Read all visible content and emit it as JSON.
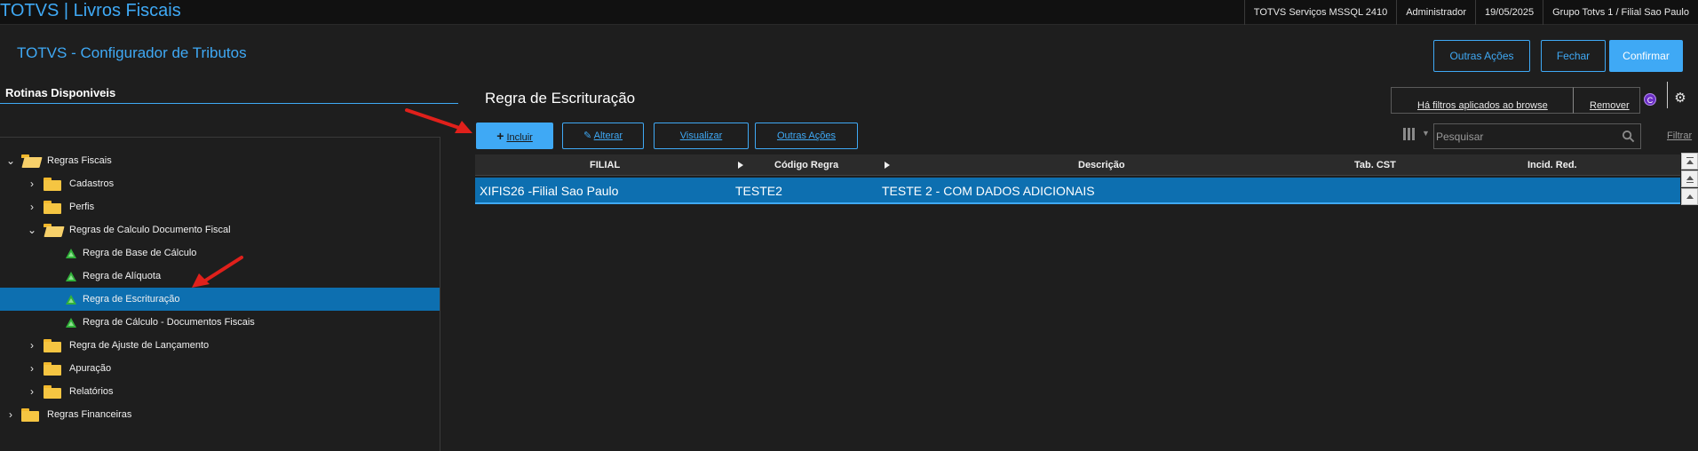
{
  "topbar": {
    "app_title": "TOTVS | Livros Fiscais",
    "server": "TOTVS Serviços MSSQL 2410",
    "user": "Administrador",
    "date": "19/05/2025",
    "branch": "Grupo Totvs 1 / Filial Sao Paulo"
  },
  "header": {
    "title": "TOTVS - Configurador de Tributos",
    "other_actions": "Outras Ações",
    "close": "Fechar",
    "confirm": "Confirmar"
  },
  "left_panel": {
    "title": "Rotinas Disponiveis",
    "tree": [
      {
        "label": "Regras Fiscais",
        "level": 0,
        "kind": "folder-open",
        "expanded": true
      },
      {
        "label": "Cadastros",
        "level": 1,
        "kind": "folder",
        "expanded": false
      },
      {
        "label": "Perfis",
        "level": 1,
        "kind": "folder",
        "expanded": false
      },
      {
        "label": "Regras de Calculo Documento Fiscal",
        "level": 1,
        "kind": "folder-open",
        "expanded": true
      },
      {
        "label": "Regra de Base de Cálculo",
        "level": 2,
        "kind": "leaf"
      },
      {
        "label": "Regra de Alíquota",
        "level": 2,
        "kind": "leaf"
      },
      {
        "label": "Regra de Escrituração",
        "level": 2,
        "kind": "leaf",
        "selected": true
      },
      {
        "label": "Regra de Cálculo - Documentos Fiscais",
        "level": 2,
        "kind": "leaf"
      },
      {
        "label": "Regra de Ajuste de Lançamento",
        "level": 1,
        "kind": "folder",
        "expanded": false
      },
      {
        "label": "Apuração",
        "level": 1,
        "kind": "folder",
        "expanded": false
      },
      {
        "label": "Relatórios",
        "level": 1,
        "kind": "folder",
        "expanded": false
      },
      {
        "label": "Regras Financeiras",
        "level": 0,
        "kind": "folder",
        "expanded": false
      }
    ]
  },
  "browse": {
    "title": "Regra de Escrituração",
    "filters_applied": "Há filtros aplicados ao browse",
    "remove": "Remover",
    "badge": "C",
    "actions": {
      "include": "Incluir",
      "alter": "Alterar",
      "view": "Visualizar",
      "other": "Outras Ações"
    },
    "search_placeholder": "Pesquisar",
    "filter_link": "Filtrar",
    "columns": [
      "FILIAL",
      "Código Regra",
      "Descrição",
      "Tab. CST",
      "Incid. Red."
    ],
    "rows": [
      {
        "filial": "XIFIS26 -Filial Sao Paulo",
        "codigo": "TESTE2",
        "descricao": "TESTE 2 - COM DADOS ADICIONAIS",
        "tab_cst": "",
        "incid_red": ""
      }
    ]
  },
  "colors": {
    "accent": "#3fa9f5",
    "selected_row": "#0d6fb0",
    "background": "#1e1e1e",
    "annotation_arrow": "#e0201b"
  },
  "icons": {
    "plus": "plus-icon",
    "pencil": "pencil-icon",
    "search": "search-icon",
    "settings": "gear-icon",
    "columns": "columns-icon"
  }
}
